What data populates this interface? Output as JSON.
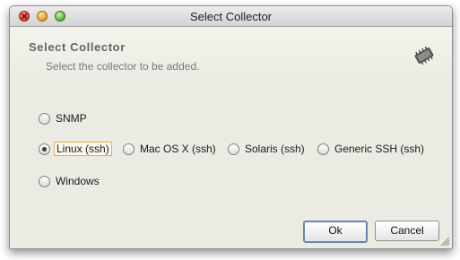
{
  "window": {
    "title": "Select Collector"
  },
  "dialog": {
    "heading": "Select Collector",
    "subtitle": "Select the collector to be added."
  },
  "options": [
    {
      "label": "SNMP",
      "checked": false
    },
    {
      "label": "Linux (ssh)",
      "checked": true
    },
    {
      "label": "Mac OS X (ssh)",
      "checked": false
    },
    {
      "label": "Solaris (ssh)",
      "checked": false
    },
    {
      "label": "Generic SSH (ssh)",
      "checked": false
    },
    {
      "label": "Windows",
      "checked": false
    }
  ],
  "buttons": {
    "ok": "Ok",
    "cancel": "Cancel"
  },
  "icons": {
    "header": "chip-icon"
  }
}
